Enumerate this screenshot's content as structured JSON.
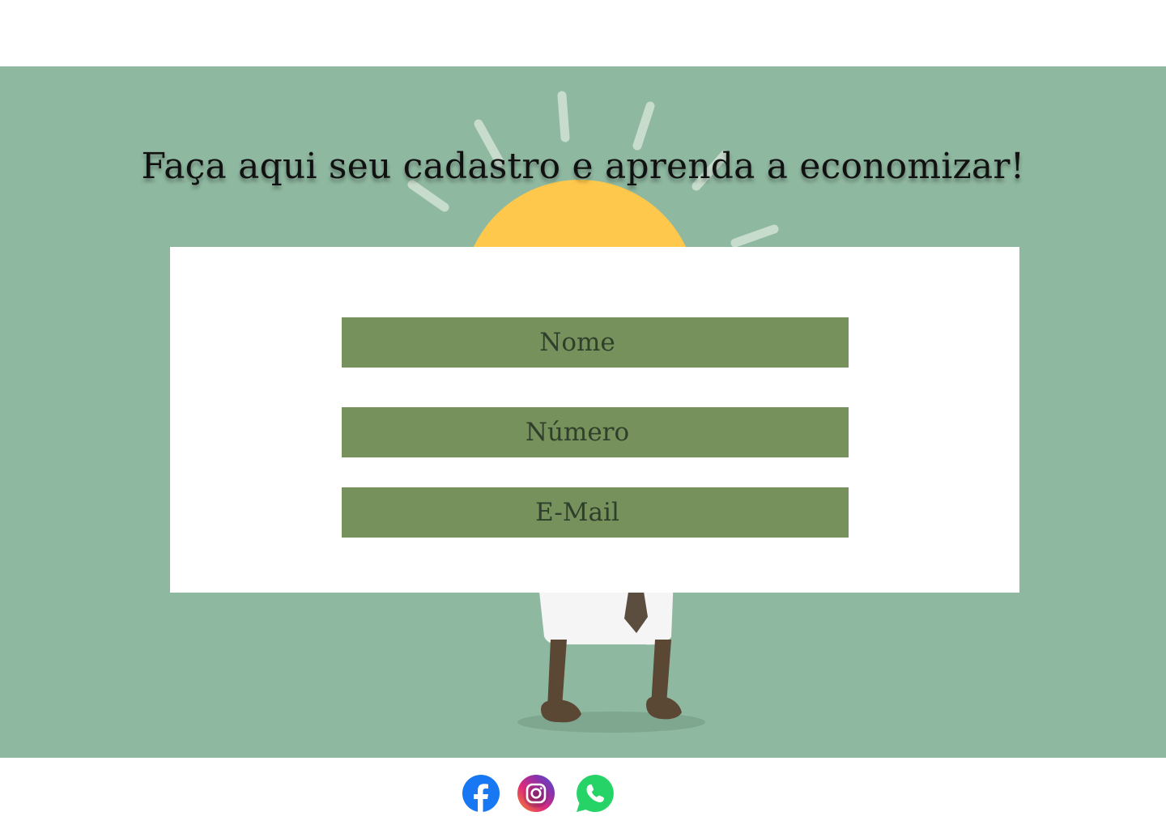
{
  "hero": {
    "headline": "Faça aqui seu cadastro e aprenda a economizar!",
    "background_color": "#8fb8a0",
    "illustration": "sun-and-businessman-illustration"
  },
  "form": {
    "fields": [
      {
        "name": "nome",
        "placeholder": "Nome"
      },
      {
        "name": "numero",
        "placeholder": "Número"
      },
      {
        "name": "email",
        "placeholder": "E-Mail"
      }
    ],
    "field_color": "#76915c"
  },
  "footer": {
    "social": [
      {
        "icon": "facebook-icon",
        "color": "#1877f2"
      },
      {
        "icon": "instagram-icon",
        "color": "#c13584"
      },
      {
        "icon": "whatsapp-icon",
        "color": "#25d366"
      }
    ]
  }
}
